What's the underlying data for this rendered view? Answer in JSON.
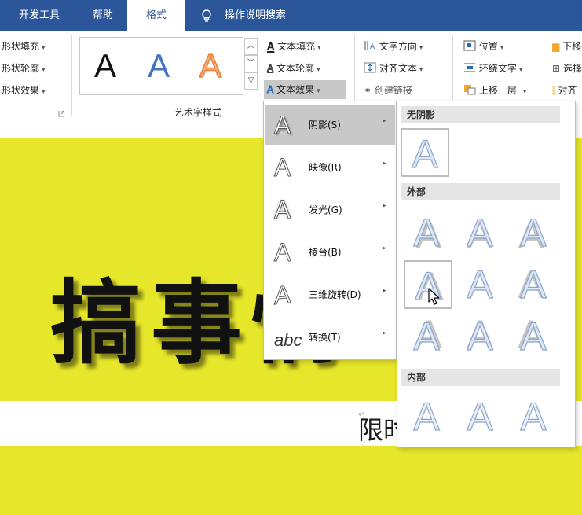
{
  "tabs": [
    {
      "label": "开发工具",
      "active": false
    },
    {
      "label": "帮助",
      "active": false
    },
    {
      "label": "格式",
      "active": true
    }
  ],
  "tell_me": {
    "label": "操作说明搜索",
    "icon": "lightbulb-icon"
  },
  "ribbon": {
    "shape_styles": {
      "fill": "形状填充",
      "outline": "形状轮廓",
      "effects": "形状效果",
      "dropdown_glyph": "▾",
      "launcher_icon": "dialog-launcher-icon"
    },
    "wordart": {
      "samples": [
        "A",
        "A",
        "A"
      ],
      "group_label": "艺术字样式",
      "text_fill": "文本填充",
      "text_outline": "文本轮廓",
      "text_effects": "文本效果",
      "dropdown_glyph": "▾"
    },
    "text_group": {
      "direction": "文字方向",
      "align": "对齐文本",
      "link": "创建链接",
      "dropdown_glyph": "▾"
    },
    "arrange": {
      "position": "位置",
      "wrap": "环绕文字",
      "bring_forward": "上移一层",
      "send_backward": "下移",
      "selection_pane": "选择",
      "align": "对齐",
      "dropdown_glyph": "▾"
    }
  },
  "document": {
    "headline": "搞事情",
    "subtitle": "限时特惠",
    "paragraph_mark": "↵",
    "background_color": "#e6e62a"
  },
  "effects_menu": [
    {
      "label": "阴影(S)",
      "icon": "A",
      "icon_name": "shadow-icon",
      "arrow": "▸",
      "highlighted": true
    },
    {
      "label": "映像(R)",
      "icon": "A",
      "icon_name": "reflection-icon",
      "arrow": "▸",
      "highlighted": false
    },
    {
      "label": "发光(G)",
      "icon": "A",
      "icon_name": "glow-icon",
      "arrow": "▸",
      "highlighted": false
    },
    {
      "label": "棱台(B)",
      "icon": "A",
      "icon_name": "bevel-icon",
      "arrow": "▸",
      "highlighted": false
    },
    {
      "label": "三维旋转(D)",
      "icon": "A",
      "icon_name": "3d-rotation-icon",
      "arrow": "▸",
      "highlighted": false
    },
    {
      "label": "转换(T)",
      "icon": "abc",
      "icon_name": "transform-icon",
      "arrow": "▸",
      "highlighted": false
    }
  ],
  "shadow_submenu": {
    "no_shadow_header": "无阴影",
    "outer_header": "外部",
    "inner_header": "内部",
    "tile_glyph": "A",
    "selected_outer_index": 3
  },
  "colors": {
    "ribbon_blue": "#2b579a",
    "highlight_gray": "#c8c8c8",
    "doc_yellow": "#e6e62a",
    "sample_blue": "#4472c4",
    "sample_orange": "#f4b183"
  }
}
